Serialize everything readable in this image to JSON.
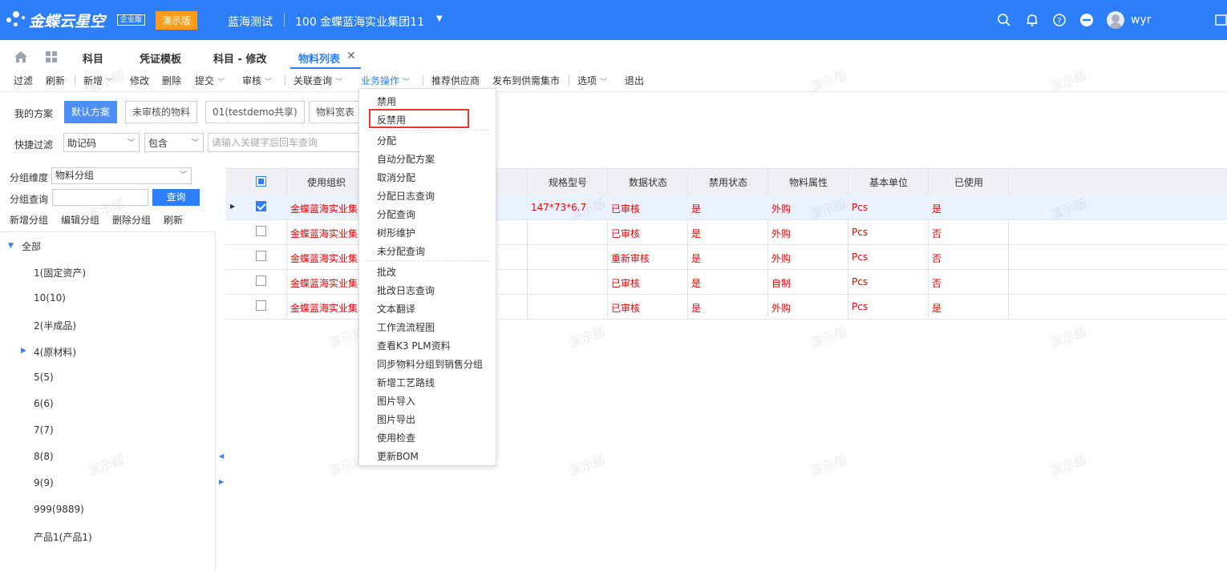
{
  "app": {
    "brand": "金蝶云星空",
    "edition": "企业版",
    "demo_badge": "演示版",
    "tenant": "蓝海测试",
    "org": "100  金蝶蓝海实业集团11",
    "user": "wyr"
  },
  "tabs": [
    "科目",
    "凭证模板",
    "科目 - 修改",
    "物料列表"
  ],
  "toolbar": {
    "filter": "过滤",
    "refresh": "刷新",
    "new": "新增",
    "modify": "修改",
    "delete": "删除",
    "submit": "提交",
    "audit": "审核",
    "related_query": "关联查询",
    "business_ops": "业务操作",
    "recommend_supplier": "推荐供应商",
    "publish_market": "发布到供需集市",
    "options": "选项",
    "exit": "退出"
  },
  "schemes": {
    "label": "我的方案",
    "default": "默认方案",
    "unaudited": "未审核的物料",
    "shared": "01(testdemo共享)",
    "wide": "物料宽表"
  },
  "quick_filter": {
    "label": "快捷过滤",
    "field": "助记码",
    "op": "包含",
    "placeholder": "请输入关键字后回车查询"
  },
  "group": {
    "dim_label": "分组维度",
    "dim_value": "物料分组",
    "query_label": "分组查询",
    "query_btn": "查询",
    "actions": [
      "新增分组",
      "编辑分组",
      "删除分组",
      "刷新"
    ],
    "tree": [
      "全部",
      "1(固定资产)",
      "10(10)",
      "2(半成品)",
      "4(原材料)",
      "5(5)",
      "6(6)",
      "7(7)",
      "8(8)",
      "9(9)",
      "999(9889)",
      "产品1(产品1)"
    ]
  },
  "grid": {
    "headers": {
      "org": "使用组织",
      "spec": "规格型号",
      "data_status": "数据状态",
      "forbid_status": "禁用状态",
      "attr": "物料属性",
      "unit": "基本单位",
      "used": "已使用"
    },
    "rows": [
      {
        "org": "金蝶蓝海实业集",
        "spec": "147*73*6.7",
        "data_status": "已审核",
        "forbid": "是",
        "attr": "外购",
        "unit": "Pcs",
        "used": "是"
      },
      {
        "org": "金蝶蓝海实业集",
        "spec": "",
        "data_status": "已审核",
        "forbid": "是",
        "attr": "外购",
        "unit": "Pcs",
        "used": "否"
      },
      {
        "org": "金蝶蓝海实业集",
        "spec": "",
        "data_status": "重新审核",
        "forbid": "是",
        "attr": "外购",
        "unit": "Pcs",
        "used": "否"
      },
      {
        "org": "金蝶蓝海实业集",
        "spec": "",
        "data_status": "已审核",
        "forbid": "是",
        "attr": "自制",
        "unit": "Pcs",
        "used": "否"
      },
      {
        "org": "金蝶蓝海实业集",
        "spec": "",
        "data_status": "已审核",
        "forbid": "是",
        "attr": "外购",
        "unit": "Pcs",
        "used": "是"
      }
    ]
  },
  "menu": [
    "禁用",
    "反禁用",
    "分配",
    "自动分配方案",
    "取消分配",
    "分配日志查询",
    "分配查询",
    "树形维护",
    "未分配查询",
    "批改",
    "批改日志查询",
    "文本翻译",
    "工作流流程图",
    "查看K3 PLM资料",
    "同步物料分组到销售分组",
    "新增工艺路线",
    "图片导入",
    "图片导出",
    "使用检查",
    "更新BOM"
  ],
  "watermark": "演示版",
  "colors": {
    "accent": "#2d7ff9",
    "demo_badge": "#ff9c1a",
    "error_text": "#e00000",
    "highlight_box": "#e33333"
  }
}
